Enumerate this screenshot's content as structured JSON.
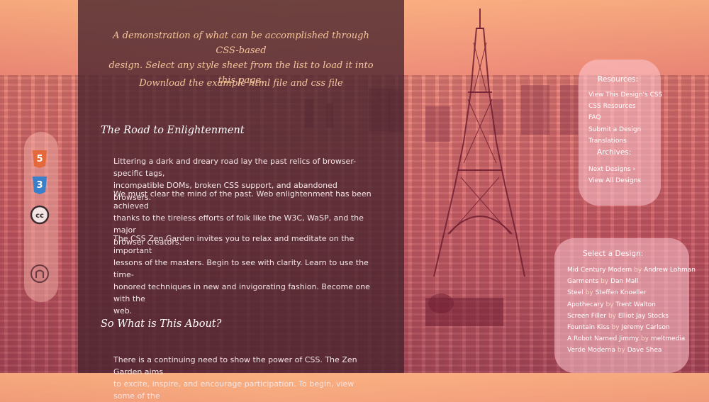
{
  "intro": {
    "line1": "A demonstration of what can be accomplished through CSS-based",
    "line2": "design. Select any style sheet from the list to load it into this page.",
    "download": "Download the example html file and css file"
  },
  "road": {
    "title": "The Road to Enlightenment",
    "p1_l1": "Littering a dark and dreary road lay the past relics of browser-specific tags,",
    "p1_l2": "incompatible DOMs, broken CSS support, and abandoned browsers.",
    "p2_l1": "We must clear the mind of the past. Web enlightenment has been achieved",
    "p2_l2": "thanks to the tireless efforts of folk like the W3C, WaSP, and the major",
    "p2_l3": "browser creators.",
    "p3_l1": "The CSS Zen Garden invites you to relax and meditate on the important",
    "p3_l2": "lessons of the masters. Begin to see with clarity. Learn to use the time-",
    "p3_l3": "honored techniques in new and invigorating fashion. Become one with the",
    "p3_l4": "web."
  },
  "about": {
    "title": "So What is This About?",
    "p1_l1": "There is a continuing need to show the power of CSS. The Zen Garden aims",
    "p1_l2": "to excite, inspire, and encourage participation. To begin, view some of the"
  },
  "icons": [
    "html5-icon",
    "css3-icon",
    "creative-commons-icon",
    "github-icon"
  ],
  "resources": {
    "title": "Resources:",
    "links": [
      "View This Design's CSS",
      "CSS Resources",
      "FAQ",
      "Submit a Design",
      "Translations"
    ],
    "archives_title": "Archives:",
    "archive_links": [
      "Next Designs ›",
      "View All Designs"
    ]
  },
  "designs": {
    "title": "Select a Design:",
    "by": "by",
    "items": [
      {
        "name": "Mid Century Modern",
        "author": "Andrew Lohman"
      },
      {
        "name": "Garments",
        "author": "Dan Mall"
      },
      {
        "name": "Steel",
        "author": "Steffen Knoeller"
      },
      {
        "name": "Apothecary",
        "author": "Trent Walton"
      },
      {
        "name": "Screen Filler",
        "author": "Elliot Jay Stocks"
      },
      {
        "name": "Fountain Kiss",
        "author": "Jeremy Carlson"
      },
      {
        "name": "A Robot Named Jimmy",
        "author": "meltmedia"
      },
      {
        "name": "Verde Moderna",
        "author": "Dave Shea"
      }
    ]
  },
  "colors": {
    "accent_text": "#f6c59a",
    "panel": "#46232d",
    "box": "#ffc8d2"
  }
}
